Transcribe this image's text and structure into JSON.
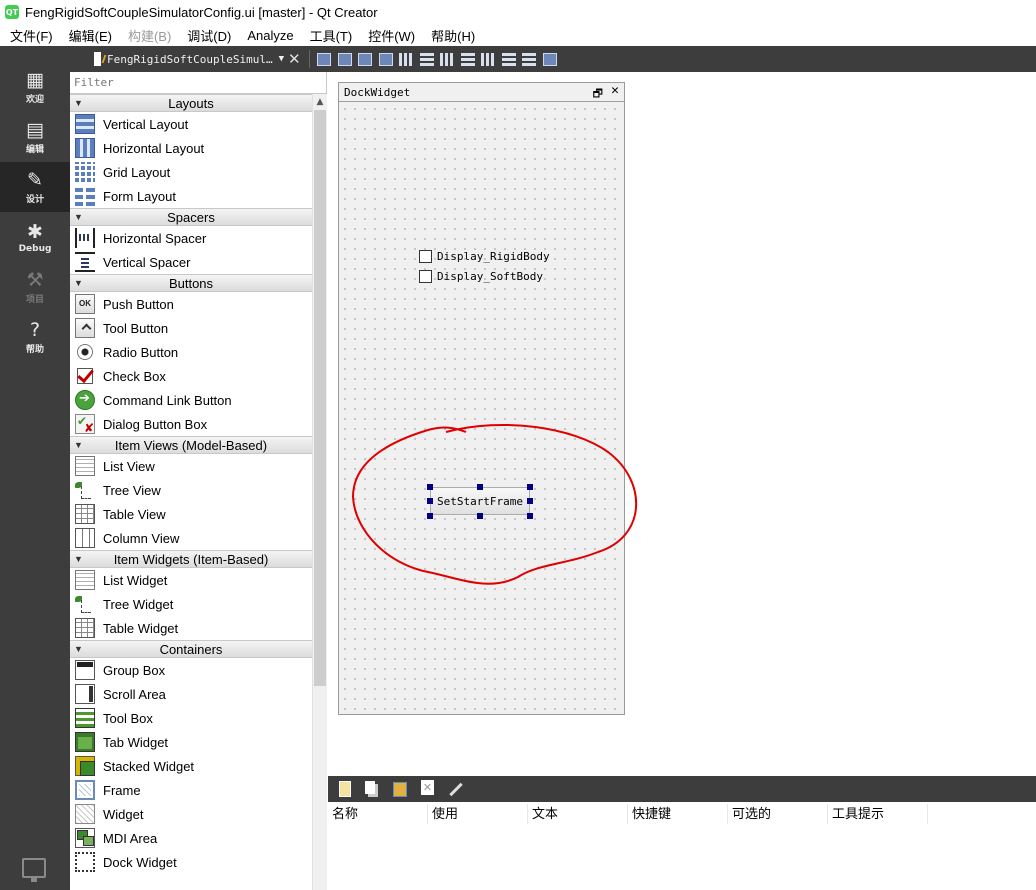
{
  "window": {
    "title": "FengRigidSoftCoupleSimulatorConfig.ui [master] - Qt Creator",
    "logo_text": "QT"
  },
  "menubar": [
    {
      "label": "文件(F)",
      "enabled": true
    },
    {
      "label": "编辑(E)",
      "enabled": true
    },
    {
      "label": "构建(B)",
      "enabled": false
    },
    {
      "label": "调试(D)",
      "enabled": true
    },
    {
      "label": "Analyze",
      "enabled": true
    },
    {
      "label": "工具(T)",
      "enabled": true
    },
    {
      "label": "控件(W)",
      "enabled": true
    },
    {
      "label": "帮助(H)",
      "enabled": true
    }
  ],
  "modes": [
    {
      "label": "欢迎",
      "icon": "grid-icon",
      "glyph": "▦",
      "active": false,
      "enabled": true
    },
    {
      "label": "编辑",
      "icon": "edit-icon",
      "glyph": "▤",
      "active": false,
      "enabled": true
    },
    {
      "label": "设计",
      "icon": "design-pen-icon",
      "glyph": "✎",
      "active": true,
      "enabled": true
    },
    {
      "label": "Debug",
      "icon": "bug-icon",
      "glyph": "✱",
      "active": false,
      "enabled": true
    },
    {
      "label": "项目",
      "icon": "wrench-icon",
      "glyph": "⚒",
      "active": false,
      "enabled": false
    },
    {
      "label": "帮助",
      "icon": "help-icon",
      "glyph": "?",
      "active": false,
      "enabled": true
    }
  ],
  "toolbar": {
    "document": "FengRigidSoftCoupleSimul…",
    "dropdown_arrow": "▼",
    "close_glyph": "✕"
  },
  "widgetbox": {
    "filter_placeholder": "Filter",
    "categories": [
      {
        "label": "Layouts",
        "items": [
          {
            "label": "Vertical Layout",
            "icon": "i-vlay",
            "name": "vertical-layout-icon"
          },
          {
            "label": "Horizontal Layout",
            "icon": "i-hlay",
            "name": "horizontal-layout-icon"
          },
          {
            "label": "Grid Layout",
            "icon": "i-grid",
            "name": "grid-layout-icon"
          },
          {
            "label": "Form Layout",
            "icon": "i-form",
            "name": "form-layout-icon"
          }
        ]
      },
      {
        "label": "Spacers",
        "items": [
          {
            "label": "Horizontal Spacer",
            "icon": "i-hspacer",
            "name": "horizontal-spacer-icon"
          },
          {
            "label": "Vertical Spacer",
            "icon": "i-vspacer",
            "name": "vertical-spacer-icon"
          }
        ]
      },
      {
        "label": "Buttons",
        "items": [
          {
            "label": "Push Button",
            "icon": "i-push",
            "name": "push-button-icon",
            "glyph": "OK"
          },
          {
            "label": "Tool Button",
            "icon": "i-tool",
            "name": "tool-button-icon"
          },
          {
            "label": "Radio Button",
            "icon": "i-radio",
            "name": "radio-button-icon"
          },
          {
            "label": "Check Box",
            "icon": "i-check",
            "name": "check-box-icon"
          },
          {
            "label": "Command Link Button",
            "icon": "i-cmdlink",
            "name": "command-link-icon"
          },
          {
            "label": "Dialog Button Box",
            "icon": "i-dlg",
            "name": "dialog-button-box-icon"
          }
        ]
      },
      {
        "label": "Item Views (Model-Based)",
        "items": [
          {
            "label": "List View",
            "icon": "i-list",
            "name": "list-view-icon"
          },
          {
            "label": "Tree View",
            "icon": "i-tree",
            "name": "tree-view-icon"
          },
          {
            "label": "Table View",
            "icon": "i-table",
            "name": "table-view-icon"
          },
          {
            "label": "Column View",
            "icon": "i-column",
            "name": "column-view-icon"
          }
        ]
      },
      {
        "label": "Item Widgets (Item-Based)",
        "items": [
          {
            "label": "List Widget",
            "icon": "i-list",
            "name": "list-widget-icon"
          },
          {
            "label": "Tree Widget",
            "icon": "i-tree",
            "name": "tree-widget-icon"
          },
          {
            "label": "Table Widget",
            "icon": "i-table",
            "name": "table-widget-icon"
          }
        ]
      },
      {
        "label": "Containers",
        "items": [
          {
            "label": "Group Box",
            "icon": "i-group",
            "name": "group-box-icon"
          },
          {
            "label": "Scroll Area",
            "icon": "i-scroll",
            "name": "scroll-area-icon"
          },
          {
            "label": "Tool Box",
            "icon": "i-toolbox",
            "name": "tool-box-icon"
          },
          {
            "label": "Tab Widget",
            "icon": "i-tab",
            "name": "tab-widget-icon"
          },
          {
            "label": "Stacked Widget",
            "icon": "i-stacked",
            "name": "stacked-widget-icon"
          },
          {
            "label": "Frame",
            "icon": "i-frame",
            "name": "frame-icon"
          },
          {
            "label": "Widget",
            "icon": "i-widget",
            "name": "widget-icon"
          },
          {
            "label": "MDI Area",
            "icon": "i-mdi",
            "name": "mdi-area-icon"
          },
          {
            "label": "Dock Widget",
            "icon": "i-dock",
            "name": "dock-widget-icon"
          }
        ]
      }
    ]
  },
  "form": {
    "dock_title": "DockWidget",
    "float_glyph": "🗗",
    "close_glyph": "✕",
    "checkboxes": [
      "Display_RigidBody",
      "Display_SoftBody"
    ],
    "button_label": "SetStartFrame",
    "annotation_color": "#e00000"
  },
  "action_editor": {
    "columns": [
      "名称",
      "使用",
      "文本",
      "快捷键",
      "可选的",
      "工具提示"
    ]
  }
}
